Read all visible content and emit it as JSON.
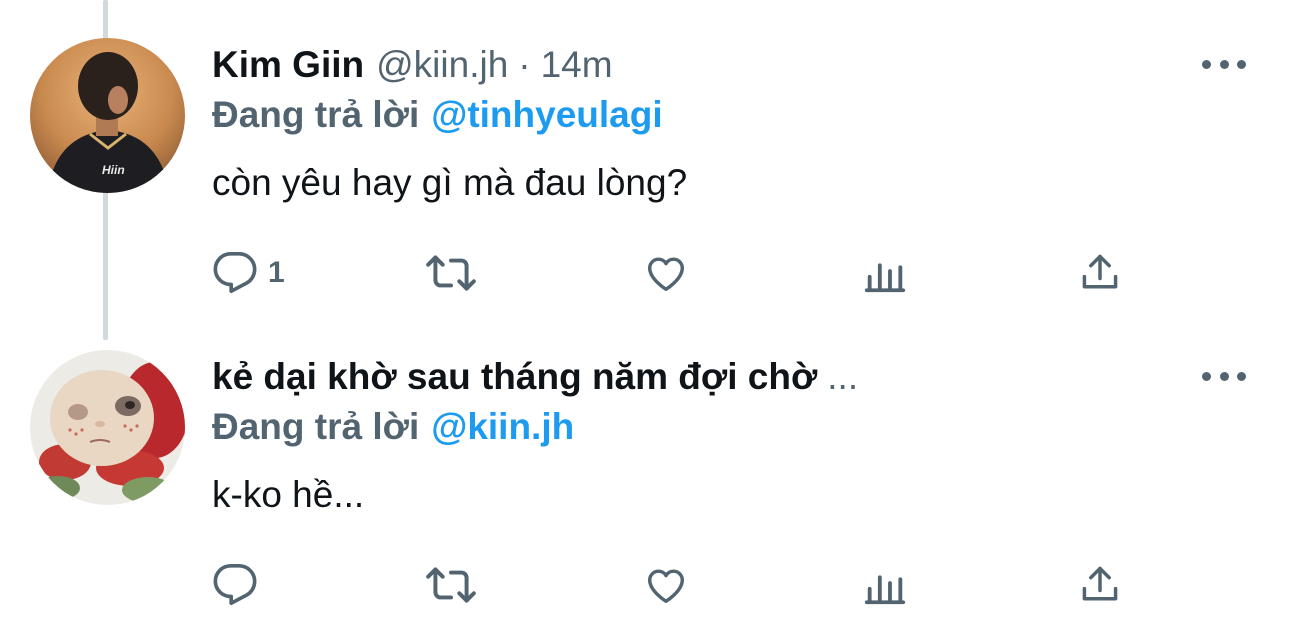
{
  "tweets": [
    {
      "author_name": "Kim Giin",
      "handle": "@kiin.jh",
      "separator": "·",
      "time": "14m",
      "reply_prefix": "Đang trả lời",
      "reply_to": "@tinhyeulagi",
      "text": "còn yêu hay gì mà đau lòng?",
      "reply_count": "1",
      "avatar_shirt_text": "Hiin"
    },
    {
      "author_name": "kẻ dại khờ sau tháng năm đợi chờ",
      "name_truncation": "...",
      "reply_prefix": "Đang trả lời",
      "reply_to": "@kiin.jh",
      "text": "k-ko hề...",
      "reply_count": ""
    }
  ],
  "colors": {
    "name": "#0f1419",
    "secondary": "#536471",
    "mention": "#1d9bf0",
    "thread_line": "#cfd9de"
  },
  "icons": [
    "reply-icon",
    "retweet-icon",
    "like-icon",
    "views-icon",
    "share-icon",
    "more-icon"
  ]
}
